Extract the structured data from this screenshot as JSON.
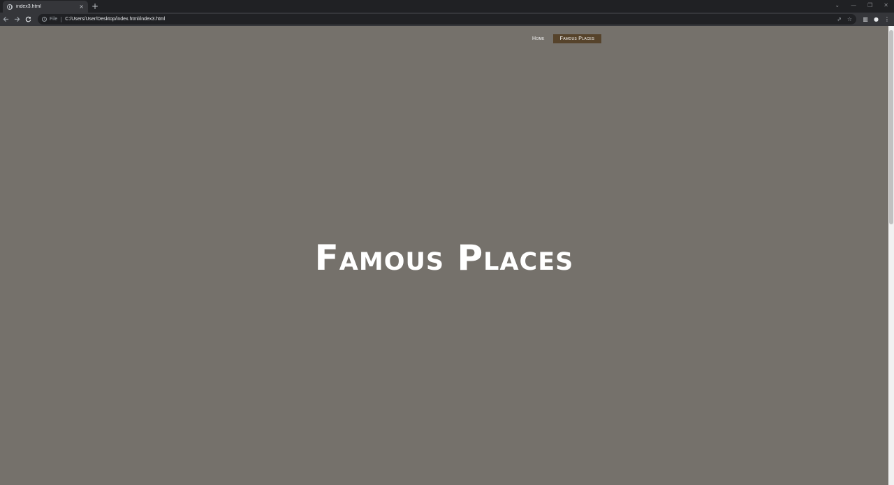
{
  "browser": {
    "tab_title": "index3.html",
    "tab_close": "×",
    "new_tab": "+",
    "scheme": "File",
    "url": "C:/Users/User/Desktop/index.html/index3.html",
    "window_controls": [
      "⌄",
      "—",
      "❐",
      "✕"
    ],
    "icons": {
      "back": "back-arrow-icon",
      "forward": "forward-arrow-icon",
      "reload": "reload-icon",
      "share": "share-icon",
      "bookmark": "star-icon",
      "sidepanel": "side-panel-icon",
      "profile": "profile-icon",
      "menu": "kebab-menu-icon"
    }
  },
  "page": {
    "background": "#75716b",
    "nav": {
      "items": [
        {
          "label": "Home",
          "active": false
        },
        {
          "label": "Famous Places",
          "active": true
        }
      ],
      "active_color": "#56432b"
    },
    "hero_title": "Famous Places"
  }
}
